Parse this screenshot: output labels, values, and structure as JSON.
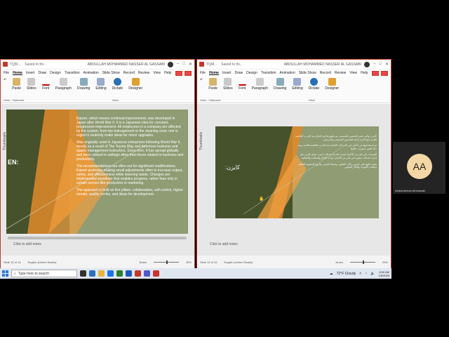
{
  "left_window": {
    "title": "TQM...",
    "save_state": "Saved to thi...",
    "user": "ABDULLAH MOHAMMED NASSER AL GASSABI",
    "menu": [
      "File",
      "Home",
      "Insert",
      "Draw",
      "Design",
      "Transition",
      "Animation",
      "Slide Show",
      "Record",
      "Review",
      "View",
      "Help"
    ],
    "ribbon": {
      "undo": "Undo",
      "paste": "Paste",
      "clipboard": "Clipboard",
      "slides": "Slides",
      "font": "Font",
      "paragraph": "Paragraph",
      "drawing": "Drawing",
      "editing": "Editing",
      "dictate": "Dictate",
      "voice": "Voice",
      "designer": "Designer"
    },
    "thumbnails_label": "Thumbnails",
    "slide": {
      "title_fragment": "EN:",
      "paragraphs": [
        "Kaizen, which means continual improvement, was developed in Japan after World War II. It is a Japanese idea for constant, progressive improvement. All employees in a company are affected by the system, from top management to the cleaning crew; one is urged to routinely make ideas for minor upgrades.",
        "Was originally used in Japanese enterprises following World War II, mostly as a result of The Toyota Way and American business and quality management instructors. Since then, it has spread globally and been utilized in settings other than those related to business and productivity.",
        "The recommendations are often not for significant modifications. Kaizen promotes making small adjustments often to increase output, safety, and effectiveness while lowering waste. Changes are implemented anywhere that enables progress, rather than only in certain sectors like production or marketing.",
        "The approach is built on five pillars: collaboration, self-control, higher morale, quality circles, and ideas for development."
      ]
    },
    "notes": "Click to add notes",
    "status": {
      "slide": "Slide 13 of 13",
      "language": "English (United States)",
      "notes": "Notes",
      "zoom": "35%"
    }
  },
  "right_window": {
    "title": "TQM...",
    "save_state": "Saved to thi...",
    "user": "ABDULLAH MOHAMMED NASSER AL GASSABI",
    "menu": [
      "File",
      "Home",
      "Insert",
      "Draw",
      "Design",
      "Transition",
      "Animation",
      "Slide Show",
      "Record",
      "Review",
      "View",
      "Help"
    ],
    "ribbon": {
      "undo": "Undo",
      "paste": "Paste",
      "clipboard": "Clipboard",
      "slides": "Slides",
      "font": "Font",
      "paragraph": "Paragraph",
      "drawing": "Drawing",
      "editing": "Editing",
      "dictate": "Dictate",
      "voice": "Voice",
      "designer": "Designer"
    },
    "thumbnails_label": "Thumbnails",
    "slide": {
      "title": "كايزن:",
      "paragraphs": [
        "كايزن، والتي تعني التحسين المستمر، تم تطويرها في اليابان بعد الحرب العالمية الثانية. إنها فكرة يابانية للتحسين المستمر والتدريجي.",
        "تم استخدامها في الأصل في الشركات اليابانية بعد الحرب العالمية الثانية، ومنذ ذلك الحين انتشرت عالميًا.",
        "التوصيات في كثير من الأحيان ليست لإجراء تعديلات كبيرة. تعمل كايزن على إجراء تعديلات صغيرة في كثير من الأحيان لزيادة الإنتاج والسلامة والفعالية.",
        "يعتمد النهج على خمس ركائز: التعاون، وضبط النفس، والروح المعنوية العالية، وحلقات الجودة، وأفكار التطوير."
      ]
    },
    "notes": "Click to add notes",
    "status": {
      "slide": "Slide 13 of 13",
      "language": "English (United States)",
      "notes": "Notes",
      "zoom": "25%"
    }
  },
  "taskbar": {
    "search_placeholder": "Type here to search",
    "weather": "72°F Cloudy",
    "time": "8:00 AM",
    "date": "1/8/2025"
  },
  "participant": {
    "initials": "AA",
    "name": "Abdulrahman AlGassabi"
  }
}
